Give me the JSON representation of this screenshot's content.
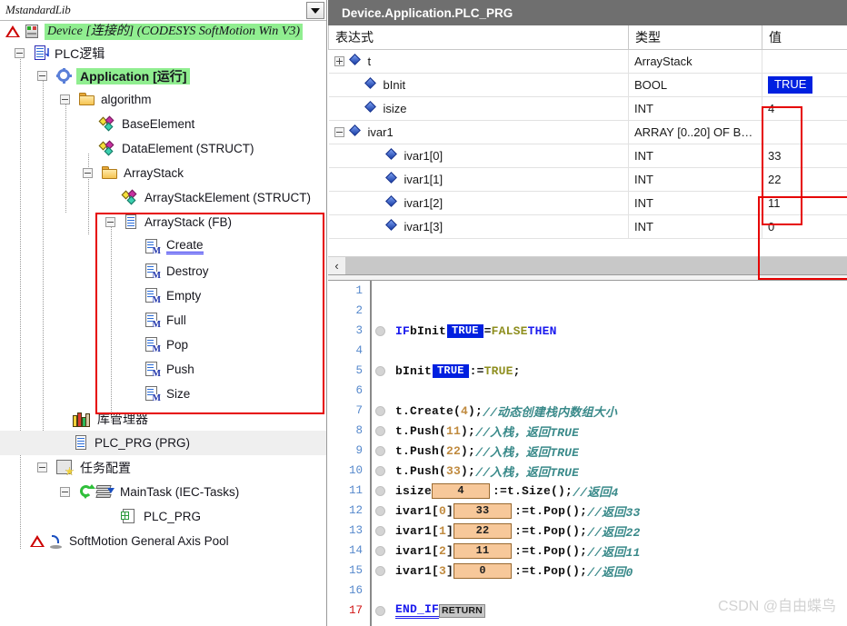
{
  "tree_panel": {
    "library_name": "MstandardLib",
    "dropdown_icon": "chevron-down-icon",
    "nodes": [
      {
        "label": "Device [连接的] (CODESYS SoftMotion Win V3)",
        "icon": "device-icon",
        "style": "green-italic",
        "indent": 0
      },
      {
        "label": "PLC逻辑",
        "icon": "plc-logic-icon",
        "style": "normal",
        "indent": 1
      },
      {
        "label": "Application [运行]",
        "icon": "application-icon",
        "style": "green-bold",
        "indent": 2
      },
      {
        "label": "algorithm",
        "icon": "folder-icon",
        "style": "normal",
        "indent": 3
      },
      {
        "label": "BaseElement",
        "icon": "struct-icon",
        "style": "normal",
        "indent": 4
      },
      {
        "label": "DataElement (STRUCT)",
        "icon": "struct-icon",
        "style": "normal",
        "indent": 4
      },
      {
        "label": "ArrayStack",
        "icon": "folder-icon",
        "style": "normal",
        "indent": 4
      },
      {
        "label": "ArrayStackElement (STRUCT)",
        "icon": "struct-icon",
        "style": "normal",
        "indent": 5
      },
      {
        "label": "ArrayStack (FB)",
        "icon": "fb-doc-icon",
        "style": "normal",
        "indent": 5
      },
      {
        "label": "Create",
        "icon": "method-icon",
        "style": "underlined",
        "indent": 6
      },
      {
        "label": "Destroy",
        "icon": "method-icon",
        "style": "normal",
        "indent": 6
      },
      {
        "label": "Empty",
        "icon": "method-icon",
        "style": "normal",
        "indent": 6
      },
      {
        "label": "Full",
        "icon": "method-icon",
        "style": "normal",
        "indent": 6
      },
      {
        "label": "Pop",
        "icon": "method-icon",
        "style": "normal",
        "indent": 6
      },
      {
        "label": "Push",
        "icon": "method-icon",
        "style": "normal",
        "indent": 6
      },
      {
        "label": "Size",
        "icon": "method-icon",
        "style": "normal",
        "indent": 6
      },
      {
        "label": "库管理器",
        "icon": "library-manager-icon",
        "style": "normal",
        "indent": 2
      },
      {
        "label": "PLC_PRG (PRG)",
        "icon": "program-doc-icon",
        "style": "selected",
        "indent": 2
      },
      {
        "label": "任务配置",
        "icon": "task-config-icon",
        "style": "normal",
        "indent": 2
      },
      {
        "label": "MainTask (IEC-Tasks)",
        "icon": "task-icon",
        "style": "normal",
        "indent": 3
      },
      {
        "label": "PLC_PRG",
        "icon": "prg-call-icon",
        "style": "normal",
        "indent": 4
      },
      {
        "label": "SoftMotion General Axis Pool",
        "icon": "axis-pool-icon",
        "style": "normal",
        "indent": 1
      }
    ],
    "highlight_green": "#90ee90",
    "highlight_select": "#efefef",
    "annotation_box_color": "#e60000"
  },
  "watch": {
    "title": "Device.Application.PLC_PRG",
    "columns": [
      "表达式",
      "类型",
      "值"
    ],
    "rows": [
      {
        "expr": "t",
        "type": "ArrayStack",
        "value": "",
        "expander": "plus",
        "depth": 0
      },
      {
        "expr": "bInit",
        "type": "BOOL",
        "value": "TRUE",
        "expander": "none",
        "depth": 1,
        "value_style": "bool-true"
      },
      {
        "expr": "isize",
        "type": "INT",
        "value": "4",
        "expander": "none",
        "depth": 1
      },
      {
        "expr": "ivar1",
        "type": "ARRAY [0..20] OF B…",
        "value": "",
        "expander": "minus",
        "depth": 0
      },
      {
        "expr": "ivar1[0]",
        "type": "INT",
        "value": "33",
        "expander": "none",
        "depth": 2
      },
      {
        "expr": "ivar1[1]",
        "type": "INT",
        "value": "22",
        "expander": "none",
        "depth": 2
      },
      {
        "expr": "ivar1[2]",
        "type": "INT",
        "value": "11",
        "expander": "none",
        "depth": 2
      },
      {
        "expr": "ivar1[3]",
        "type": "INT",
        "value": "0",
        "expander": "none",
        "depth": 2
      }
    ],
    "scroll_left_icon": "chevron-left-icon",
    "true_badge_bg": "#0020e0"
  },
  "editor": {
    "lines": [
      {
        "n": "1",
        "marker": false,
        "tokens": []
      },
      {
        "n": "2",
        "marker": false,
        "tokens": []
      },
      {
        "n": "3",
        "marker": true,
        "tokens": [
          {
            "t": "kw",
            "v": "IF "
          },
          {
            "t": "id",
            "v": "bInit"
          },
          {
            "t": "mon-true",
            "v": "TRUE"
          },
          {
            "t": "punc",
            "v": " = "
          },
          {
            "t": "kw2",
            "v": "FALSE"
          },
          {
            "t": "punc",
            "v": " "
          },
          {
            "t": "kw",
            "v": "THEN"
          }
        ]
      },
      {
        "n": "4",
        "marker": false,
        "tokens": []
      },
      {
        "n": "5",
        "marker": true,
        "tokens": [
          {
            "t": "id",
            "v": "bInit"
          },
          {
            "t": "mon-true",
            "v": "TRUE"
          },
          {
            "t": "punc",
            "v": " := "
          },
          {
            "t": "kw2",
            "v": "TRUE"
          },
          {
            "t": "punc",
            "v": ";"
          }
        ]
      },
      {
        "n": "6",
        "marker": false,
        "tokens": []
      },
      {
        "n": "7",
        "marker": true,
        "tokens": [
          {
            "t": "id",
            "v": "t.Create"
          },
          {
            "t": "punc",
            "v": "("
          },
          {
            "t": "num",
            "v": "4"
          },
          {
            "t": "punc",
            "v": ");"
          },
          {
            "t": "cmt",
            "v": "//动态创建栈内数组大小"
          }
        ]
      },
      {
        "n": "8",
        "marker": true,
        "tokens": [
          {
            "t": "id",
            "v": "t.Push"
          },
          {
            "t": "punc",
            "v": "("
          },
          {
            "t": "num",
            "v": "11"
          },
          {
            "t": "punc",
            "v": ");"
          },
          {
            "t": "cmt",
            "v": "//入栈，返回TRUE"
          }
        ]
      },
      {
        "n": "9",
        "marker": true,
        "tokens": [
          {
            "t": "id",
            "v": "t.Push"
          },
          {
            "t": "punc",
            "v": "("
          },
          {
            "t": "num",
            "v": "22"
          },
          {
            "t": "punc",
            "v": ");"
          },
          {
            "t": "cmt",
            "v": "//入栈，返回TRUE"
          }
        ]
      },
      {
        "n": "10",
        "marker": true,
        "tokens": [
          {
            "t": "id",
            "v": "t.Push"
          },
          {
            "t": "punc",
            "v": "("
          },
          {
            "t": "num",
            "v": "33"
          },
          {
            "t": "punc",
            "v": ");"
          },
          {
            "t": "cmt",
            "v": "//入栈，返回TRUE"
          }
        ]
      },
      {
        "n": "11",
        "marker": true,
        "tokens": [
          {
            "t": "id",
            "v": "isize"
          },
          {
            "t": "mon-box",
            "v": "4"
          },
          {
            "t": "punc",
            "v": " := "
          },
          {
            "t": "id",
            "v": "t.Size"
          },
          {
            "t": "punc",
            "v": "();"
          },
          {
            "t": "cmt",
            "v": "//返回4"
          }
        ]
      },
      {
        "n": "12",
        "marker": true,
        "tokens": [
          {
            "t": "id",
            "v": "ivar1"
          },
          {
            "t": "punc",
            "v": "["
          },
          {
            "t": "num",
            "v": "0"
          },
          {
            "t": "punc",
            "v": "]"
          },
          {
            "t": "mon-box",
            "v": "33"
          },
          {
            "t": "punc",
            "v": " := "
          },
          {
            "t": "id",
            "v": "t.Pop"
          },
          {
            "t": "punc",
            "v": "(); "
          },
          {
            "t": "cmt",
            "v": "//返回33"
          }
        ]
      },
      {
        "n": "13",
        "marker": true,
        "tokens": [
          {
            "t": "id",
            "v": "ivar1"
          },
          {
            "t": "punc",
            "v": "["
          },
          {
            "t": "num",
            "v": "1"
          },
          {
            "t": "punc",
            "v": "]"
          },
          {
            "t": "mon-box",
            "v": "22"
          },
          {
            "t": "punc",
            "v": " := "
          },
          {
            "t": "id",
            "v": "t.Pop"
          },
          {
            "t": "punc",
            "v": "(); "
          },
          {
            "t": "cmt",
            "v": "//返回22"
          }
        ]
      },
      {
        "n": "14",
        "marker": true,
        "tokens": [
          {
            "t": "id",
            "v": "ivar1"
          },
          {
            "t": "punc",
            "v": "["
          },
          {
            "t": "num",
            "v": "2"
          },
          {
            "t": "punc",
            "v": "]"
          },
          {
            "t": "mon-box",
            "v": "11"
          },
          {
            "t": "punc",
            "v": " := "
          },
          {
            "t": "id",
            "v": "t.Pop"
          },
          {
            "t": "punc",
            "v": "(); "
          },
          {
            "t": "cmt",
            "v": "//返回11"
          }
        ]
      },
      {
        "n": "15",
        "marker": true,
        "tokens": [
          {
            "t": "id",
            "v": "ivar1"
          },
          {
            "t": "punc",
            "v": "["
          },
          {
            "t": "num",
            "v": "3"
          },
          {
            "t": "punc",
            "v": "]"
          },
          {
            "t": "mon-box",
            "v": "0"
          },
          {
            "t": "punc",
            "v": " := "
          },
          {
            "t": "id",
            "v": "t.Pop"
          },
          {
            "t": "punc",
            "v": "(); "
          },
          {
            "t": "cmt",
            "v": "//返回0"
          }
        ]
      },
      {
        "n": "16",
        "marker": false,
        "tokens": []
      },
      {
        "n": "17",
        "marker": true,
        "num_style": "err",
        "tokens": [
          {
            "t": "kw-u",
            "v": "END_IF"
          },
          {
            "t": "mon-ret",
            "v": "RETURN"
          }
        ]
      }
    ]
  },
  "watermark": "CSDN @自由蝶鸟"
}
